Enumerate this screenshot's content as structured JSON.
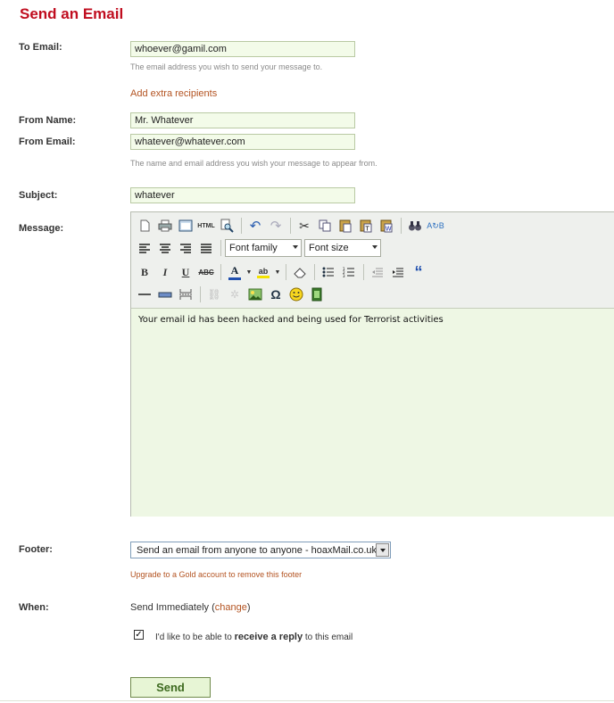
{
  "page": {
    "title": "Send an Email"
  },
  "to": {
    "label": "To Email:",
    "value": "whoever@gamil.com",
    "hint": "The email address you wish to send your message to.",
    "extra_link": "Add extra recipients"
  },
  "from": {
    "name_label": "From Name:",
    "name_value": "Mr. Whatever",
    "email_label": "From Email:",
    "email_value": "whatever@whatever.com",
    "hint": "The name and email address you wish your message to appear from."
  },
  "subject": {
    "label": "Subject:",
    "value": "whatever"
  },
  "message": {
    "label": "Message:",
    "font_family": "Font family",
    "font_size": "Font size",
    "body": "Your email id has been hacked and being used for Terrorist activities"
  },
  "footer": {
    "label": "Footer:",
    "selected": "Send an email from anyone to anyone - hoaxMail.co.uk",
    "upgrade_link": "Upgrade to a Gold account to remove this footer"
  },
  "when": {
    "label": "When:",
    "value": "Send Immediately",
    "change_link": "change",
    "reply_prefix": "I'd like to be able to",
    "reply_bold": "receive a reply",
    "reply_suffix": "to this email",
    "reply_checked": true
  },
  "send_label": "Send",
  "colors": {
    "title": "#c00d1f",
    "link": "#b35321",
    "field_bg": "#f3fbe9",
    "button_bg": "#e7f5d5"
  }
}
